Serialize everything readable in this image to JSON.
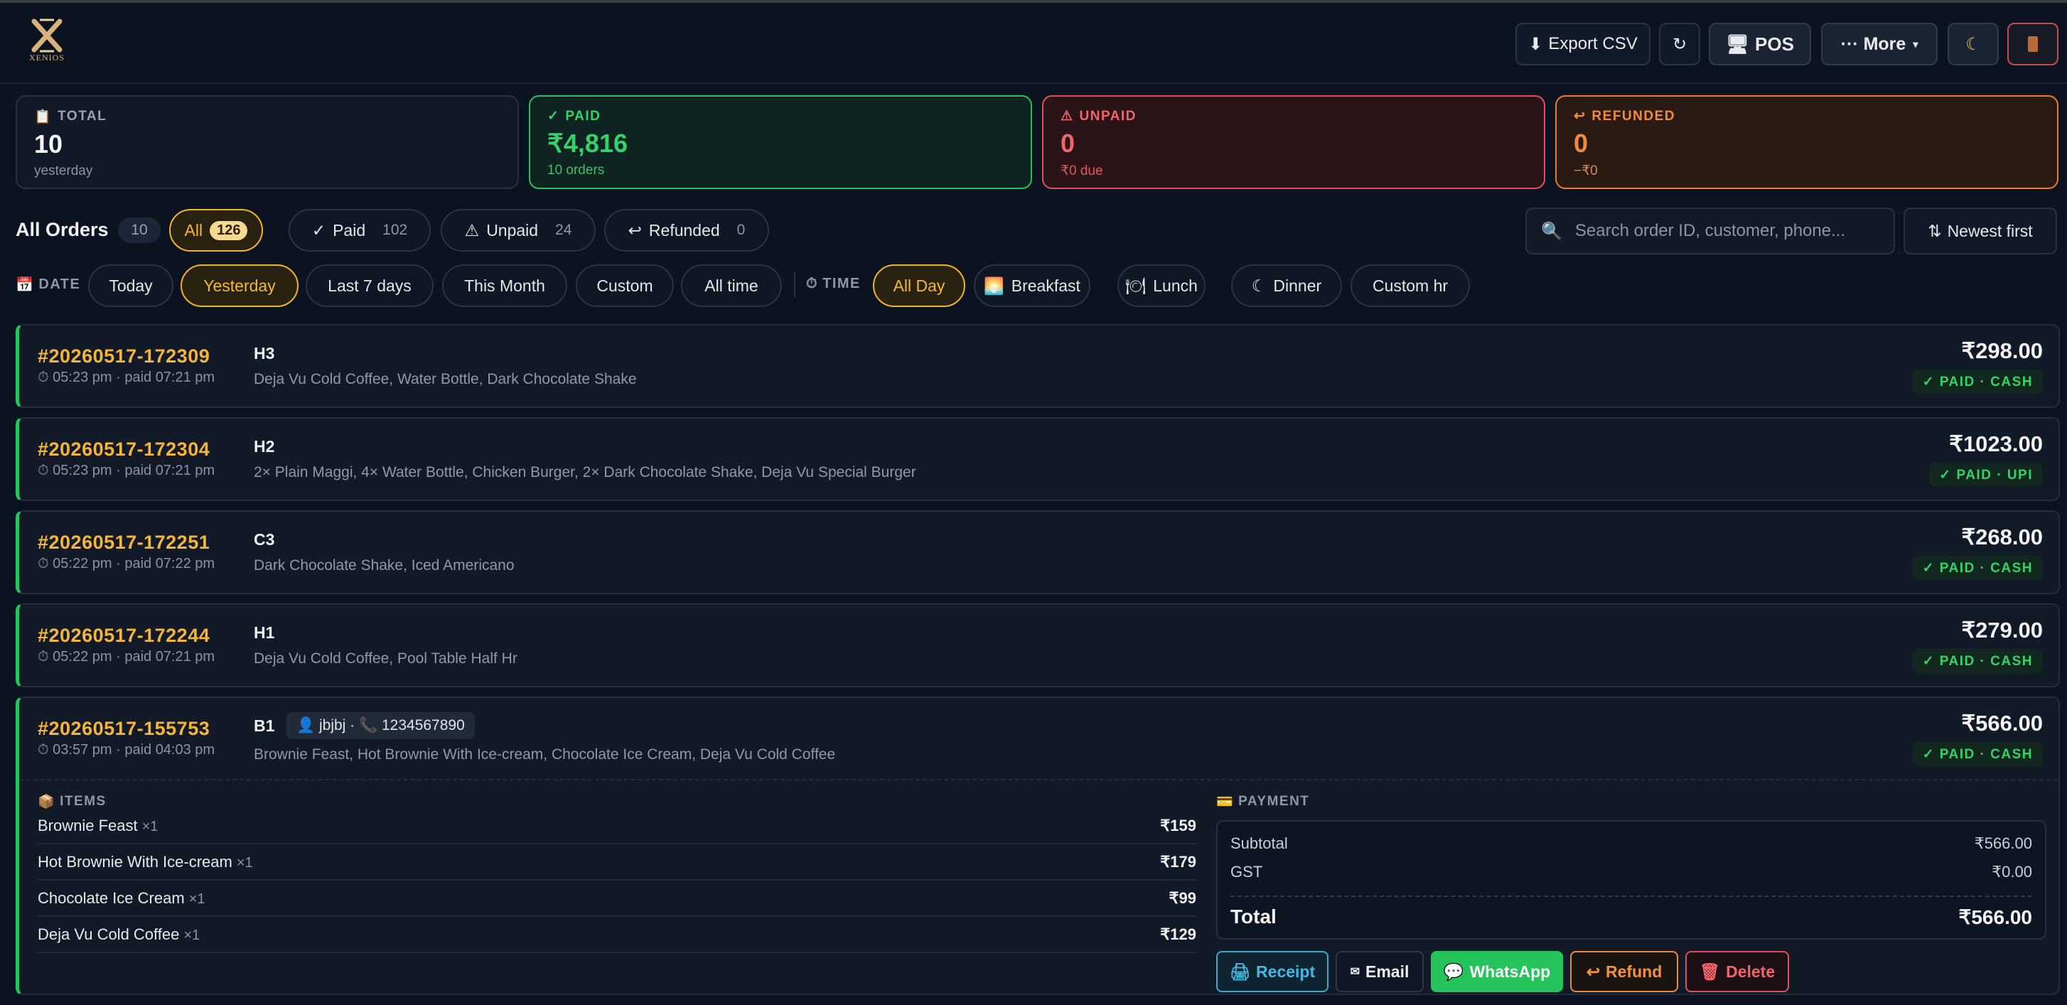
{
  "header": {
    "logo_text": "XENIOS",
    "export_label": "Export CSV",
    "refresh_icon": "refresh-icon",
    "pos_label": "POS",
    "more_label": "··· More",
    "theme_icon": "moon-icon",
    "exit_icon": "door-icon"
  },
  "stats": {
    "total": {
      "label": "TOTAL",
      "value": "10",
      "sub": "yesterday"
    },
    "paid": {
      "label": "PAID",
      "value": "₹4,816",
      "sub": "10 orders"
    },
    "unpaid": {
      "label": "UNPAID",
      "value": "0",
      "sub": "₹0 due"
    },
    "refunded": {
      "label": "REFUNDED",
      "value": "0",
      "sub": "−₹0"
    }
  },
  "filters": {
    "title": "All Orders",
    "title_count": "10",
    "status": [
      {
        "label": "All",
        "count": "126"
      },
      {
        "label": "Paid",
        "count": "102"
      },
      {
        "label": "Unpaid",
        "count": "24"
      },
      {
        "label": "Refunded",
        "count": "0"
      }
    ],
    "search_placeholder": "Search order ID, customer, phone...",
    "sort_label": "Newest first",
    "date_label": "DATE",
    "dates": [
      "Today",
      "Yesterday",
      "Last 7 days",
      "This Month",
      "Custom",
      "All time"
    ],
    "time_label": "TIME",
    "times": [
      "All Day",
      "Breakfast",
      "Lunch",
      "Dinner",
      "Custom hr"
    ]
  },
  "orders": [
    {
      "id": "#20260517-172309",
      "time": "⏱ 05:23 pm · paid 07:21 pm",
      "table": "H3",
      "items": "Deja Vu Cold Coffee, Water Bottle, Dark Chocolate Shake",
      "amount": "₹298.00",
      "status": "✓ PAID · CASH"
    },
    {
      "id": "#20260517-172304",
      "time": "⏱ 05:23 pm · paid 07:21 pm",
      "table": "H2",
      "items": "2× Plain Maggi, 4× Water Bottle, Chicken Burger, 2× Dark Chocolate Shake, Deja Vu Special Burger",
      "amount": "₹1023.00",
      "status": "✓ PAID · UPI"
    },
    {
      "id": "#20260517-172251",
      "time": "⏱ 05:22 pm · paid 07:22 pm",
      "table": "C3",
      "items": "Dark Chocolate Shake, Iced Americano",
      "amount": "₹268.00",
      "status": "✓ PAID · CASH"
    },
    {
      "id": "#20260517-172244",
      "time": "⏱ 05:22 pm · paid 07:21 pm",
      "table": "H1",
      "items": "Deja Vu Cold Coffee, Pool Table Half Hr",
      "amount": "₹279.00",
      "status": "✓ PAID · CASH"
    }
  ],
  "expanded": {
    "id": "#20260517-155753",
    "time": "⏱ 03:57 pm · paid 04:03 pm",
    "table": "B1",
    "customer": "👤 jbjbj · 📞 1234567890",
    "items_summary": "Brownie Feast, Hot Brownie With Ice-cream, Chocolate Ice Cream, Deja Vu Cold Coffee",
    "amount": "₹566.00",
    "status": "✓ PAID · CASH",
    "items_label": "ITEMS",
    "items": [
      {
        "name": "Brownie Feast",
        "qty": "×1",
        "price": "₹159"
      },
      {
        "name": "Hot Brownie With Ice-cream",
        "qty": "×1",
        "price": "₹179"
      },
      {
        "name": "Chocolate Ice Cream",
        "qty": "×1",
        "price": "₹99"
      },
      {
        "name": "Deja Vu Cold Coffee",
        "qty": "×1",
        "price": "₹129"
      }
    ],
    "payment_label": "PAYMENT",
    "subtotal_label": "Subtotal",
    "subtotal": "₹566.00",
    "gst_label": "GST",
    "gst": "₹0.00",
    "total_label": "Total",
    "total": "₹566.00",
    "actions": {
      "receipt": "Receipt",
      "email": "Email",
      "whatsapp": "WhatsApp",
      "refund": "Refund",
      "delete": "Delete"
    }
  },
  "colors": {
    "accent": "#f5b53a",
    "paid": "#22c55e",
    "unpaid": "#e0525a",
    "refund": "#f07a2a"
  }
}
